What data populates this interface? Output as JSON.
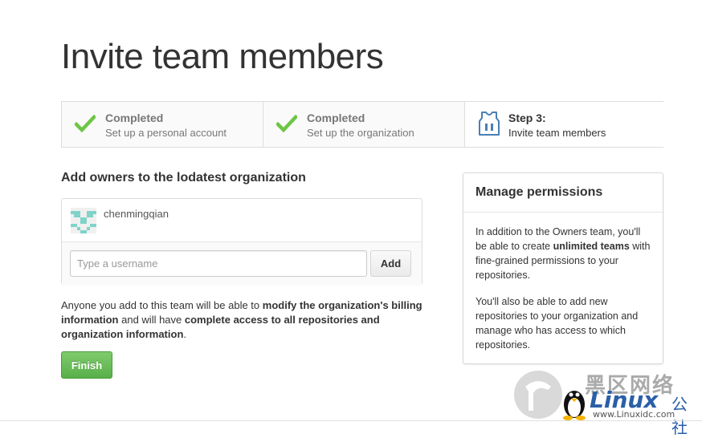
{
  "page": {
    "title": "Invite team members"
  },
  "steps": [
    {
      "title": "Completed",
      "subtitle": "Set up a personal account",
      "icon": "check-icon",
      "status": "completed"
    },
    {
      "title": "Completed",
      "subtitle": "Set up the organization",
      "icon": "check-icon",
      "status": "completed"
    },
    {
      "title": "Step 3:",
      "subtitle": "Invite team members",
      "icon": "jersey-icon",
      "status": "current"
    }
  ],
  "owners": {
    "heading": "Add owners to the lodatest organization",
    "members": [
      {
        "username": "chenmingqian",
        "avatar_icon": "identicon"
      }
    ],
    "input_placeholder": "Type a username",
    "input_value": "",
    "add_label": "Add"
  },
  "notice": {
    "t1": "Anyone you add to this team will be able to ",
    "b1": "modify the organization's billing information",
    "t2": " and will have ",
    "b2": "complete access to all repositories and organization information",
    "t3": "."
  },
  "finish_label": "Finish",
  "permissions": {
    "title": "Manage permissions",
    "p1_before": "In addition to the Owners team, you'll be able to create ",
    "p1_bold": "unlimited teams",
    "p1_after": " with fine-grained permissions to your repositories.",
    "p2": "You'll also be able to add new repositories to your organization and manage who has access to which repositories."
  },
  "watermark": {
    "cn_text": "黑区网络",
    "logo_text": "Linux",
    "logo_suffix": "公社",
    "url": "www.Linuxidc.com"
  },
  "colors": {
    "check_green": "#6cc644",
    "finish_green": "#60b044",
    "jersey_blue": "#4a7fb5",
    "watermark_blue": "#2a5fa8"
  }
}
